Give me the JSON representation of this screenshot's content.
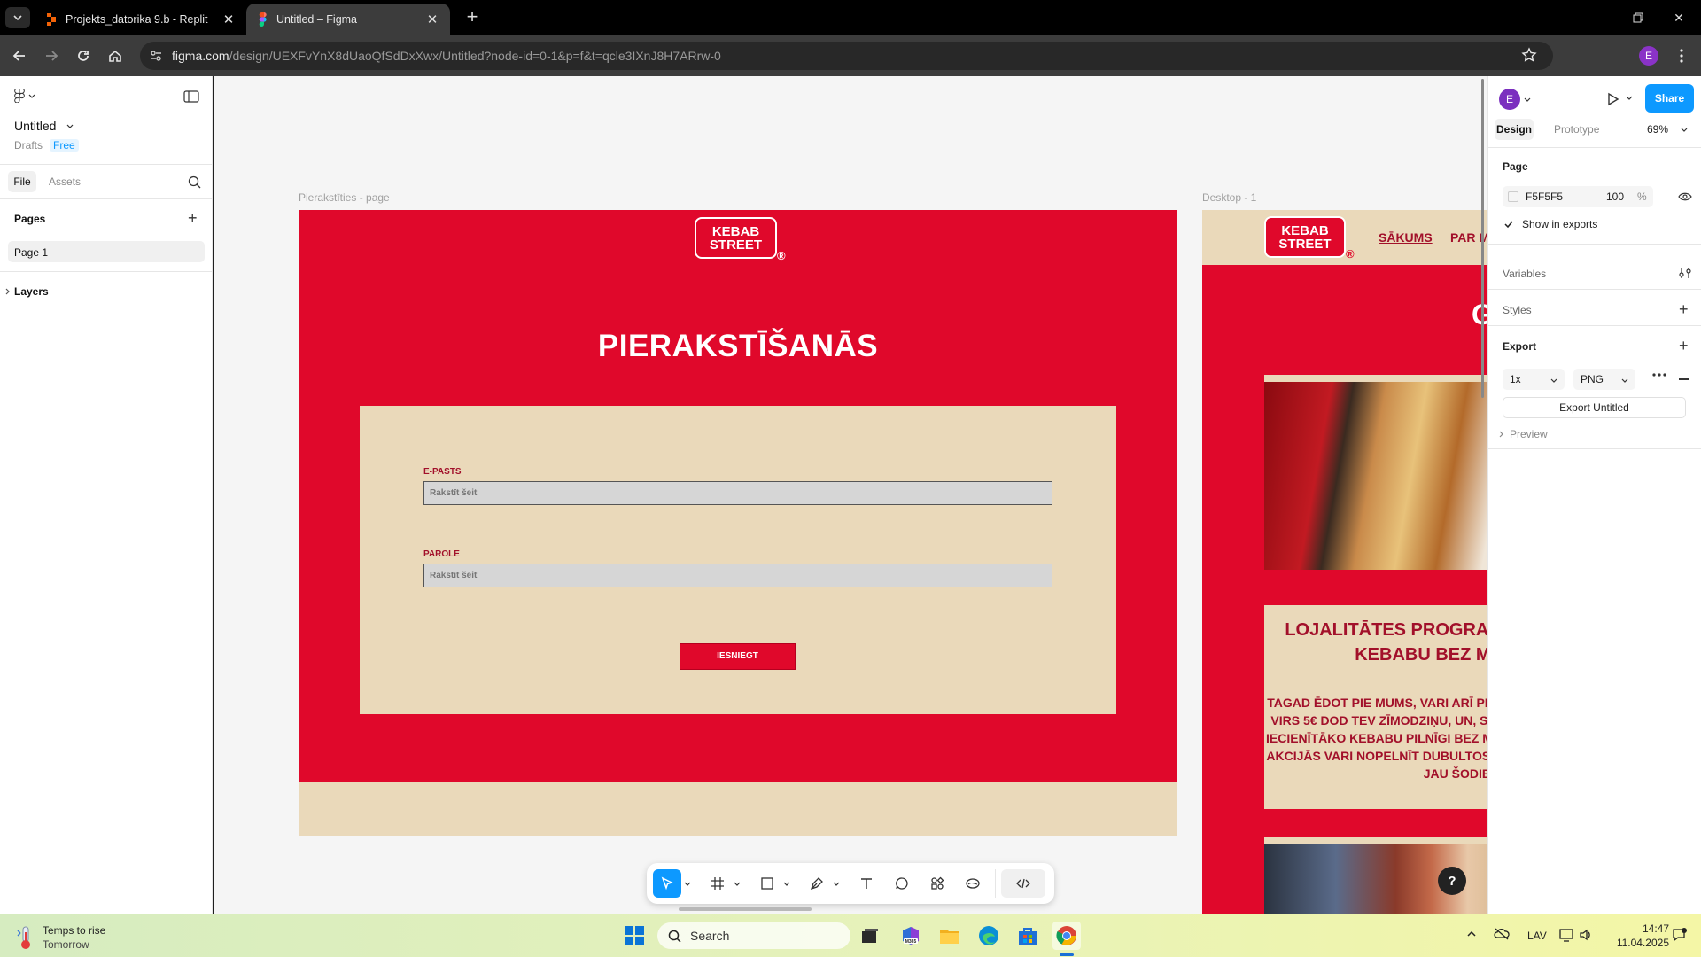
{
  "browser": {
    "tabs": [
      {
        "title": "Projekts_datorika 9.b - Replit",
        "active": false
      },
      {
        "title": "Untitled – Figma",
        "active": true
      }
    ],
    "url_host": "figma.com",
    "url_path": "/design/UEXFvYnX8dUaoQfSdDxXwx/Untitled?node-id=0-1&p=f&t=qcle3IXnJ8H7ARrw-0",
    "profile_initial": "E"
  },
  "figma": {
    "file_name": "Untitled",
    "location": "Drafts",
    "plan": "Free",
    "left_tabs": [
      "File",
      "Assets"
    ],
    "pages_heading": "Pages",
    "pages": [
      "Page 1"
    ],
    "layers_heading": "Layers",
    "right": {
      "user_initial": "E",
      "share_label": "Share",
      "tabs": [
        "Design",
        "Prototype"
      ],
      "zoom": "69%",
      "page_heading": "Page",
      "page_color": "F5F5F5",
      "page_opacity": "100",
      "opacity_unit": "%",
      "show_in_exports": "Show in exports",
      "variables": "Variables",
      "styles": "Styles",
      "export_heading": "Export",
      "export_scale": "1x",
      "export_format": "PNG",
      "export_button": "Export Untitled",
      "preview": "Preview"
    },
    "help": "?"
  },
  "canvas": {
    "frame1": {
      "label": "Pierakstīties - page",
      "logo_line1": "KEBAB",
      "logo_line2": "STREET",
      "logo_mark": "®",
      "heading": "PIERAKSTĪŠANĀS",
      "email_label": "E-PASTS",
      "email_placeholder": "Rakstīt šeit",
      "password_label": "PAROLE",
      "password_placeholder": "Rakstīt šeit",
      "submit": "IESNIEGT",
      "colors": {
        "red": "#E0082B",
        "beige": "#EAD9BA",
        "field": "#D6D6D6"
      }
    },
    "frame2": {
      "label": "Desktop - 1",
      "logo_line1": "KEBAB",
      "logo_line2": "STREET",
      "logo_mark": "®",
      "nav": [
        "SĀKUMS",
        "PAR M"
      ],
      "hero_char": "G",
      "promo_title_1": "LOJALITĀTES PROGRAM",
      "promo_title_2": "KEBABU BEZ MA",
      "promo_text": [
        "TAGAD ĒDOT PIE MUMS, VARI ARĪ PEL",
        "VIRS 5€ DOD TEV ZĪMODZIŅU, UN, SA",
        "IECIENĪTĀKO KEBABU PILNĪGI BEZ MA",
        "AKCIJĀS VARI NOPELNĪT DUBULTOS Z",
        "JAU ŠODIEN!"
      ]
    }
  },
  "taskbar": {
    "weather_title": "Temps to rise",
    "weather_sub": "Tomorrow",
    "search": "Search",
    "lang": "LAV",
    "time": "14:47",
    "date": "11.04.2025"
  }
}
